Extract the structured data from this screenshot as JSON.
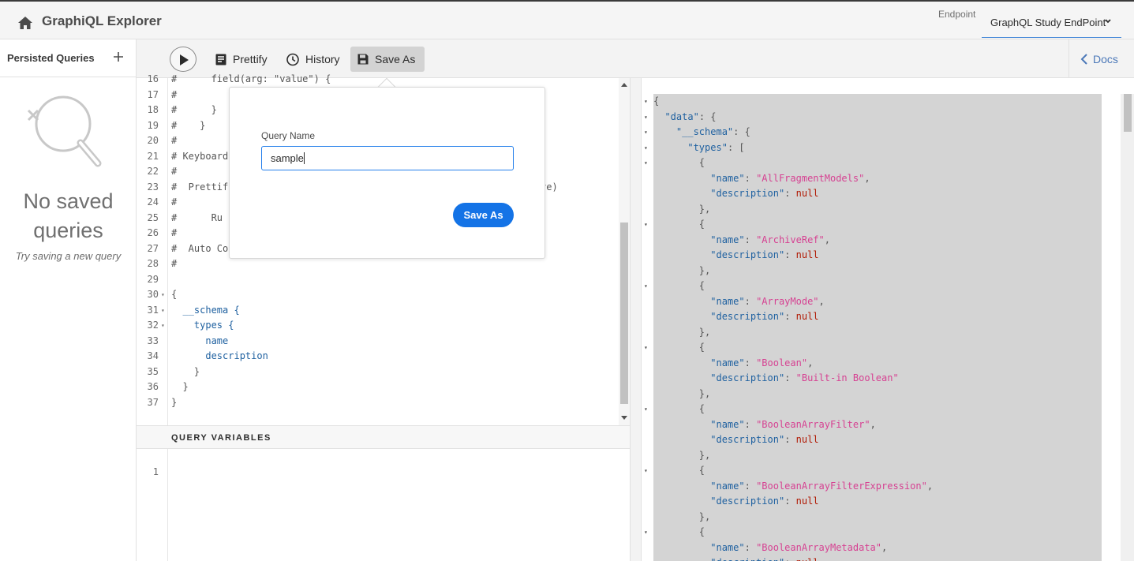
{
  "header": {
    "title": "GraphiQL Explorer",
    "endpoint_label": "Endpoint",
    "endpoint_value": "GraphQL Study EndPoint"
  },
  "sidebar": {
    "title": "Persisted Queries",
    "empty_title": "No saved queries",
    "empty_subtitle": "Try saving a new query"
  },
  "toolbar": {
    "prettify": "Prettify",
    "history": "History",
    "save_as": "Save As",
    "docs": "Docs"
  },
  "editor": {
    "lines": [
      {
        "n": "16",
        "text": "#      field(arg: \"value\") {",
        "cls": "punc",
        "fold": ""
      },
      {
        "n": "17",
        "text": "#",
        "cls": "punc",
        "fold": ""
      },
      {
        "n": "18",
        "text": "#      }",
        "cls": "punc",
        "fold": ""
      },
      {
        "n": "19",
        "text": "#    }",
        "cls": "punc",
        "fold": ""
      },
      {
        "n": "20",
        "text": "#",
        "cls": "punc",
        "fold": ""
      },
      {
        "n": "21",
        "text": "# Keyboard",
        "cls": "punc",
        "fold": ""
      },
      {
        "n": "22",
        "text": "#",
        "cls": "punc",
        "fold": ""
      },
      {
        "n": "23",
        "text": "#  Prettif",
        "cls": "punc",
        "fold": "",
        "tail": "ve)"
      },
      {
        "n": "24",
        "text": "#",
        "cls": "punc",
        "fold": ""
      },
      {
        "n": "25",
        "text": "#      Ru",
        "cls": "punc",
        "fold": ""
      },
      {
        "n": "26",
        "text": "#",
        "cls": "punc",
        "fold": ""
      },
      {
        "n": "27",
        "text": "#  Auto Co",
        "cls": "punc",
        "fold": ""
      },
      {
        "n": "28",
        "text": "#",
        "cls": "punc",
        "fold": ""
      },
      {
        "n": "29",
        "text": "",
        "cls": "punc",
        "fold": ""
      },
      {
        "n": "30",
        "text": "{",
        "cls": "punc",
        "fold": "▾"
      },
      {
        "n": "31",
        "text": "  __schema {",
        "cls": "field",
        "fold": "▾"
      },
      {
        "n": "32",
        "text": "    types {",
        "cls": "field",
        "fold": "▾"
      },
      {
        "n": "33",
        "text": "      name",
        "cls": "field",
        "fold": ""
      },
      {
        "n": "34",
        "text": "      description",
        "cls": "field",
        "fold": ""
      },
      {
        "n": "35",
        "text": "    }",
        "cls": "punc",
        "fold": ""
      },
      {
        "n": "36",
        "text": "  }",
        "cls": "punc",
        "fold": ""
      },
      {
        "n": "37",
        "text": "}",
        "cls": "punc",
        "fold": ""
      }
    ]
  },
  "query_variables": {
    "title": "QUERY VARIABLES",
    "line": "1"
  },
  "save_dialog": {
    "label": "Query Name",
    "value": "sample",
    "button": "Save As"
  },
  "result": {
    "lines": [
      {
        "fold": "▾",
        "html": "{"
      },
      {
        "fold": "▾",
        "html": "  <span class=\"k\">\"data\"</span>: {"
      },
      {
        "fold": "▾",
        "html": "    <span class=\"k\">\"__schema\"</span>: {"
      },
      {
        "fold": "▾",
        "html": "      <span class=\"k\">\"types\"</span>: ["
      },
      {
        "fold": "▾",
        "html": "        {"
      },
      {
        "fold": "",
        "html": "          <span class=\"k\">\"name\"</span>: <span class=\"s\">\"AllFragmentModels\"</span>,"
      },
      {
        "fold": "",
        "html": "          <span class=\"k\">\"description\"</span>: <span class=\"n\">null</span>"
      },
      {
        "fold": "",
        "html": "        },"
      },
      {
        "fold": "▾",
        "html": "        {"
      },
      {
        "fold": "",
        "html": "          <span class=\"k\">\"name\"</span>: <span class=\"s\">\"ArchiveRef\"</span>,"
      },
      {
        "fold": "",
        "html": "          <span class=\"k\">\"description\"</span>: <span class=\"n\">null</span>"
      },
      {
        "fold": "",
        "html": "        },"
      },
      {
        "fold": "▾",
        "html": "        {"
      },
      {
        "fold": "",
        "html": "          <span class=\"k\">\"name\"</span>: <span class=\"s\">\"ArrayMode\"</span>,"
      },
      {
        "fold": "",
        "html": "          <span class=\"k\">\"description\"</span>: <span class=\"n\">null</span>"
      },
      {
        "fold": "",
        "html": "        },"
      },
      {
        "fold": "▾",
        "html": "        {"
      },
      {
        "fold": "",
        "html": "          <span class=\"k\">\"name\"</span>: <span class=\"s\">\"Boolean\"</span>,"
      },
      {
        "fold": "",
        "html": "          <span class=\"k\">\"description\"</span>: <span class=\"s\">\"Built-in Boolean\"</span>"
      },
      {
        "fold": "",
        "html": "        },"
      },
      {
        "fold": "▾",
        "html": "        {"
      },
      {
        "fold": "",
        "html": "          <span class=\"k\">\"name\"</span>: <span class=\"s\">\"BooleanArrayFilter\"</span>,"
      },
      {
        "fold": "",
        "html": "          <span class=\"k\">\"description\"</span>: <span class=\"n\">null</span>"
      },
      {
        "fold": "",
        "html": "        },"
      },
      {
        "fold": "▾",
        "html": "        {"
      },
      {
        "fold": "",
        "html": "          <span class=\"k\">\"name\"</span>: <span class=\"s\">\"BooleanArrayFilterExpression\"</span>,"
      },
      {
        "fold": "",
        "html": "          <span class=\"k\">\"description\"</span>: <span class=\"n\">null</span>"
      },
      {
        "fold": "",
        "html": "        },"
      },
      {
        "fold": "▾",
        "html": "        {"
      },
      {
        "fold": "",
        "html": "          <span class=\"k\">\"name\"</span>: <span class=\"s\">\"BooleanArrayMetadata\"</span>,"
      },
      {
        "fold": "",
        "html": "          <span class=\"k\">\"description\"</span>: <span class=\"n\">null</span>"
      }
    ]
  }
}
